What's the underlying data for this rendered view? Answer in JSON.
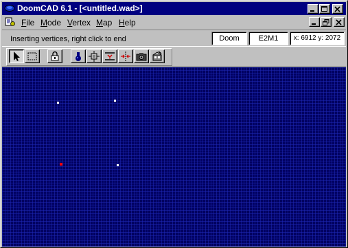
{
  "window": {
    "title": "DoomCAD 6.1 - [<untitled.wad>]"
  },
  "title_buttons": [
    "minimize-icon",
    "maximize-icon",
    "close-icon"
  ],
  "menu": {
    "items": [
      {
        "label": "File",
        "accel": "F",
        "rest": "ile"
      },
      {
        "label": "Mode",
        "accel": "M",
        "rest": "ode"
      },
      {
        "label": "Vertex",
        "accel": "V",
        "rest": "ertex"
      },
      {
        "label": "Map",
        "accel": "M",
        "rest": "ap"
      },
      {
        "label": "Help",
        "accel": "H",
        "rest": "elp"
      }
    ],
    "mdi_buttons": [
      "mdi-minimize-icon",
      "mdi-restore-icon",
      "mdi-close-icon"
    ]
  },
  "status": {
    "message": "Inserting vertices, right click to end",
    "game": "Doom",
    "level": "E2M1",
    "coords": "x: 6912 y: 2072"
  },
  "toolbar": {
    "tools": [
      "select-arrow-icon",
      "box-select-icon",
      "lock-icon",
      "thing-icon",
      "vertex-tool-icon",
      "line-split-icon",
      "line-join-icon",
      "camera-icon",
      "build-icon"
    ],
    "pressed": "select-arrow-icon"
  },
  "colors": {
    "titlebar": "#000080",
    "canvas": "#000060",
    "grid": "#1e28b4",
    "vertex": "#ffffff",
    "active_vertex": "#ff0000"
  },
  "vertex_count": 4,
  "active_vertex_count": 1
}
